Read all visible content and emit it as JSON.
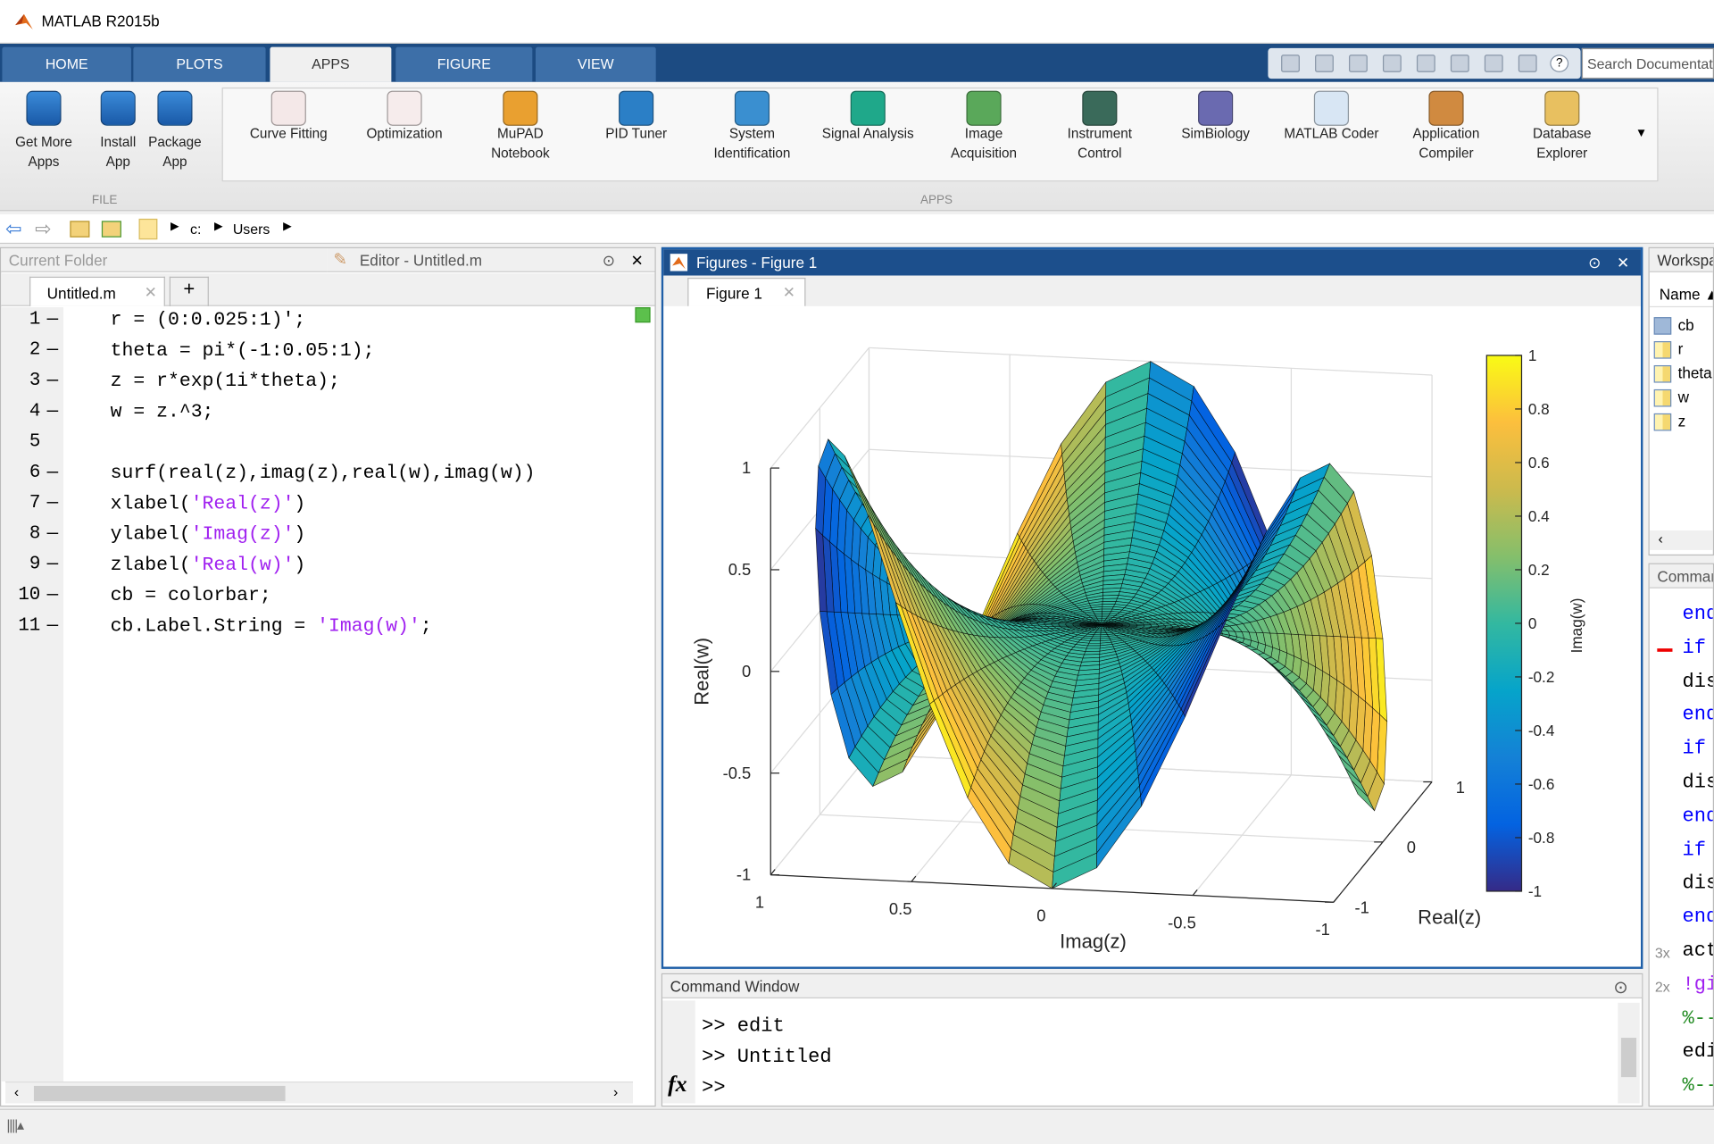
{
  "window": {
    "title": "MATLAB R2015b"
  },
  "tabs": [
    {
      "label": "HOME"
    },
    {
      "label": "PLOTS"
    },
    {
      "label": "APPS",
      "selected": true
    },
    {
      "label": "FIGURE"
    },
    {
      "label": "VIEW"
    }
  ],
  "search": {
    "placeholder": "Search Documentation"
  },
  "ribbon": {
    "file_section": "FILE",
    "apps_section": "APPS",
    "file_buttons": [
      {
        "label1": "Get More",
        "label2": "Apps",
        "icon": "download-icon"
      },
      {
        "label1": "Install",
        "label2": "App",
        "icon": "install-icon"
      },
      {
        "label1": "Package",
        "label2": "App",
        "icon": "package-icon"
      }
    ],
    "apps": [
      {
        "label1": "Curve Fitting",
        "label2": "",
        "color": "#f4e8e8"
      },
      {
        "label1": "Optimization",
        "label2": "",
        "color": "#f6ecec"
      },
      {
        "label1": "MuPAD",
        "label2": "Notebook",
        "color": "#e9a030"
      },
      {
        "label1": "PID Tuner",
        "label2": "",
        "color": "#2b7fc6"
      },
      {
        "label1": "System",
        "label2": "Identification",
        "color": "#3a8fd0"
      },
      {
        "label1": "Signal Analysis",
        "label2": "",
        "color": "#1fa88a"
      },
      {
        "label1": "Image",
        "label2": "Acquisition",
        "color": "#5aa85a"
      },
      {
        "label1": "Instrument",
        "label2": "Control",
        "color": "#3a6a5a"
      },
      {
        "label1": "SimBiology",
        "label2": "",
        "color": "#6a6ab0"
      },
      {
        "label1": "MATLAB Coder",
        "label2": "",
        "color": "#d8e6f4"
      },
      {
        "label1": "Application",
        "label2": "Compiler",
        "color": "#d08a40"
      },
      {
        "label1": "Database",
        "label2": "Explorer",
        "color": "#e8c060"
      }
    ]
  },
  "address": {
    "path": [
      "c:",
      "Users"
    ]
  },
  "current_folder": {
    "title": "Current Folder"
  },
  "editor": {
    "title": "Editor - Untitled.m",
    "tab": "Untitled.m",
    "lines": [
      {
        "n": "1",
        "dash": true,
        "parts": [
          {
            "t": "r = (0:0.025:1)';"
          }
        ]
      },
      {
        "n": "2",
        "dash": true,
        "parts": [
          {
            "t": "theta = pi*(-1:0.05:1);"
          }
        ]
      },
      {
        "n": "3",
        "dash": true,
        "parts": [
          {
            "t": "z = r*exp(1i*theta);"
          }
        ]
      },
      {
        "n": "4",
        "dash": true,
        "parts": [
          {
            "t": "w = z.^3;"
          }
        ]
      },
      {
        "n": "5",
        "dash": false,
        "parts": []
      },
      {
        "n": "6",
        "dash": true,
        "parts": [
          {
            "t": "surf(real(z),imag(z),real(w),imag(w))"
          }
        ]
      },
      {
        "n": "7",
        "dash": true,
        "parts": [
          {
            "t": "xlabel("
          },
          {
            "t": "'Real(z)'",
            "s": true
          },
          {
            "t": ")"
          }
        ]
      },
      {
        "n": "8",
        "dash": true,
        "parts": [
          {
            "t": "ylabel("
          },
          {
            "t": "'Imag(z)'",
            "s": true
          },
          {
            "t": ")"
          }
        ]
      },
      {
        "n": "9",
        "dash": true,
        "parts": [
          {
            "t": "zlabel("
          },
          {
            "t": "'Real(w)'",
            "s": true
          },
          {
            "t": ")"
          }
        ]
      },
      {
        "n": "10",
        "dash": true,
        "parts": [
          {
            "t": "cb = colorbar;"
          }
        ]
      },
      {
        "n": "11",
        "dash": true,
        "parts": [
          {
            "t": "cb.Label.String = "
          },
          {
            "t": "'Imag(w)'",
            "s": true
          },
          {
            "t": ";"
          }
        ]
      }
    ]
  },
  "figure": {
    "title": "Figures - Figure 1",
    "tab": "Figure 1"
  },
  "chart_data": {
    "type": "surface",
    "equation": "surf(real(z),imag(z),real(w),imag(w)), z=r*exp(1i*theta), w=z.^3",
    "r": {
      "start": 0,
      "step": 0.025,
      "end": 1
    },
    "theta_over_pi": {
      "start": -1,
      "step": 0.05,
      "end": 1
    },
    "xlabel": "Real(z)",
    "ylabel": "Imag(z)",
    "zlabel": "Real(w)",
    "xticks": [
      "-1",
      "0",
      "1"
    ],
    "yticks": [
      "1",
      "0.5",
      "0",
      "-0.5",
      "-1"
    ],
    "zticks": [
      "1",
      "0.5",
      "0",
      "-0.5",
      "-1"
    ],
    "xlim": [
      -1,
      1
    ],
    "ylim": [
      -1,
      1
    ],
    "zlim": [
      -1,
      1
    ],
    "colorbar": {
      "label": "Imag(w)",
      "ticks": [
        "1",
        "0.8",
        "0.6",
        "0.4",
        "0.2",
        "0",
        "-0.2",
        "-0.4",
        "-0.6",
        "-0.8",
        "-1"
      ],
      "clim": [
        -1,
        1
      ],
      "colormap": "parula"
    },
    "grid": true
  },
  "command_window": {
    "title": "Command Window",
    "lines": [
      ">> edit",
      ">> Untitled"
    ],
    "prompt": ">>"
  },
  "workspace": {
    "title": "Workspace",
    "name_col": "Name",
    "vars": [
      {
        "name": "cb",
        "icon": "object-icon"
      },
      {
        "name": "r",
        "icon": "matrix-icon"
      },
      {
        "name": "theta",
        "icon": "matrix-icon"
      },
      {
        "name": "w",
        "icon": "matrix-icon"
      },
      {
        "name": "z",
        "icon": "matrix-icon"
      }
    ]
  },
  "history": {
    "title": "Command History",
    "lines": [
      {
        "t": "end",
        "c": "#0000ff"
      },
      {
        "t": "if",
        "c": "#0000ff"
      },
      {
        "t": "dis",
        "c": "#000"
      },
      {
        "t": "end",
        "c": "#0000ff"
      },
      {
        "t": "if",
        "c": "#0000ff"
      },
      {
        "t": "dis",
        "c": "#000"
      },
      {
        "t": "end",
        "c": "#0000ff"
      },
      {
        "t": "if",
        "c": "#0000ff"
      },
      {
        "t": "dis",
        "c": "#000"
      },
      {
        "t": "end",
        "c": "#0000ff"
      },
      {
        "t": "act",
        "c": "#000",
        "count": "3x"
      },
      {
        "t": "!gi",
        "c": "#a020f0",
        "count": "2x"
      },
      {
        "t": "%--",
        "c": "#228b22"
      },
      {
        "t": "edi",
        "c": "#000"
      },
      {
        "t": "%--",
        "c": "#228b22"
      }
    ]
  }
}
